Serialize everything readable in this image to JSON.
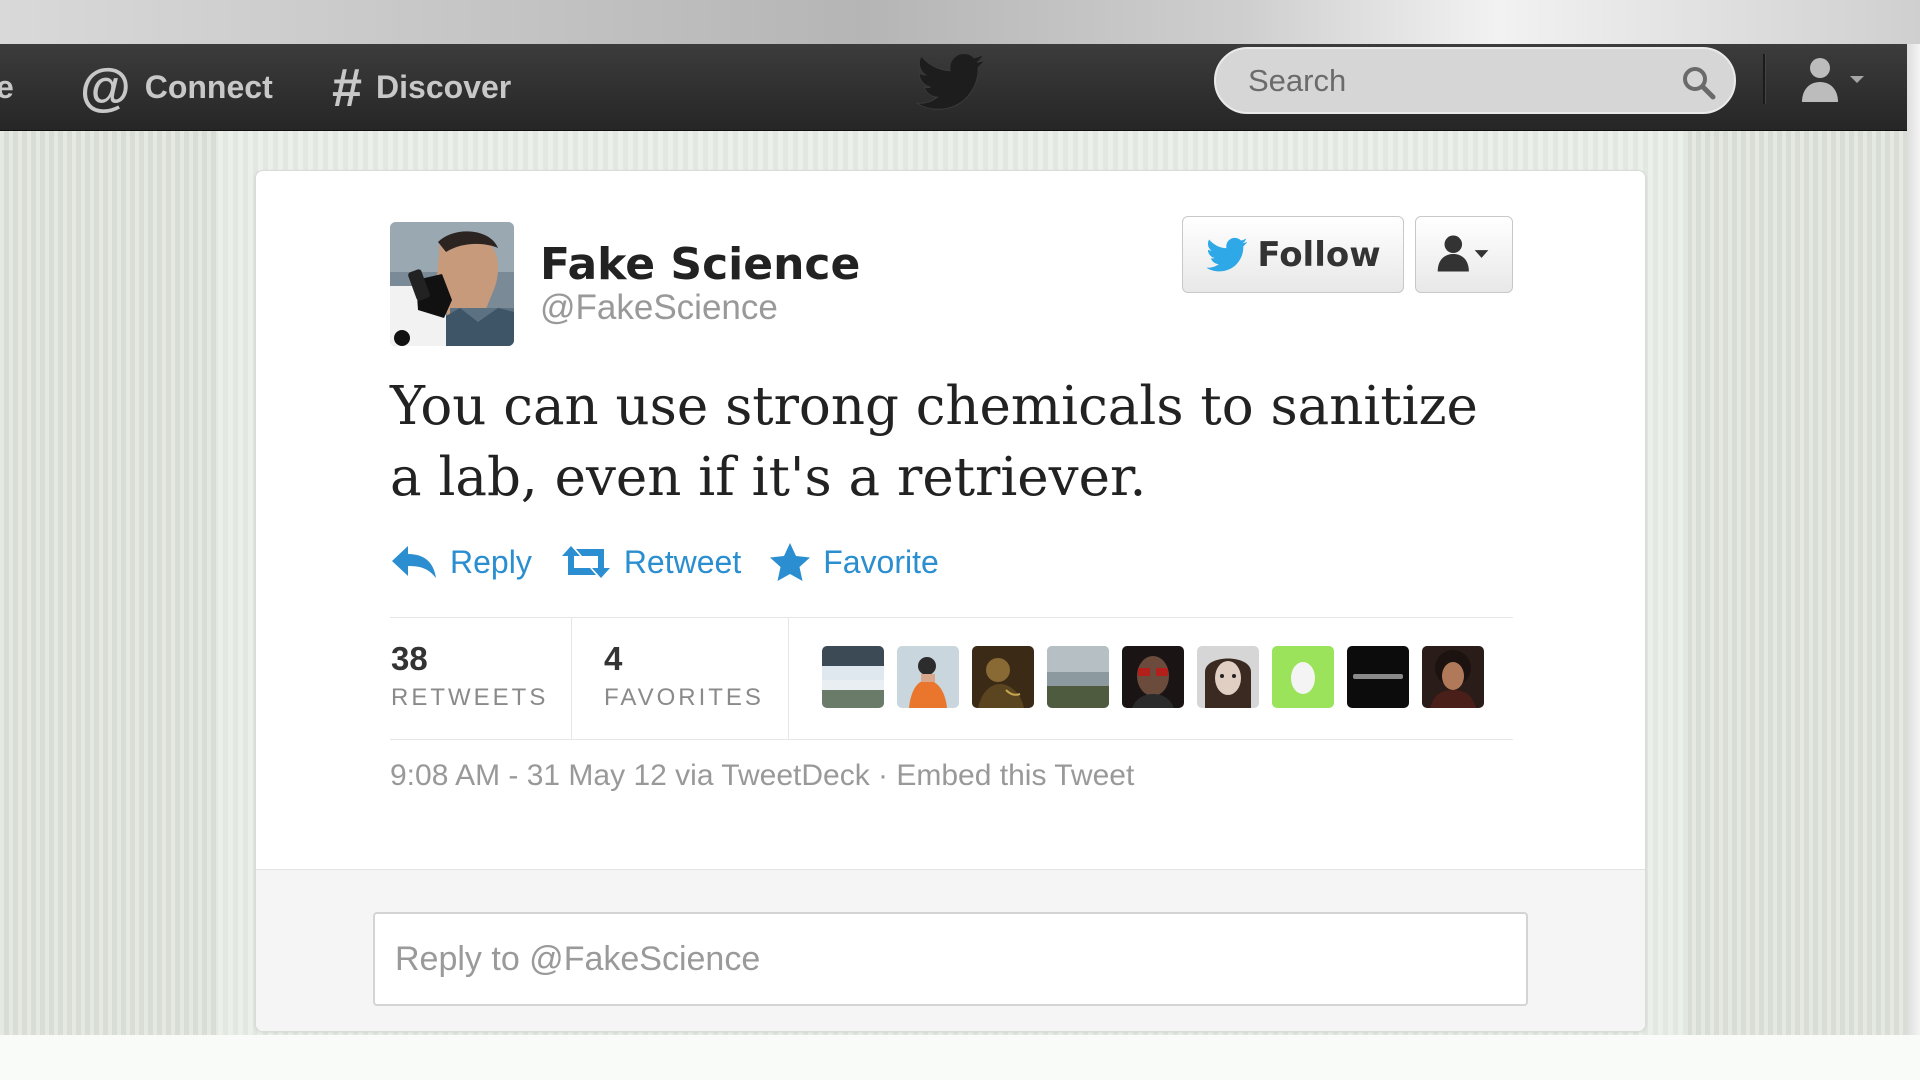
{
  "nav": {
    "home_fragment": "e",
    "connect_label": "Connect",
    "connect_glyph": "@",
    "discover_label": "Discover",
    "discover_glyph": "#",
    "search_placeholder": "Search"
  },
  "tweet": {
    "author_name": "Fake Science",
    "author_handle": "@FakeScience",
    "follow_label": "Follow",
    "text": "You can use strong chemicals to sanitize a lab, even if it's a retriever.",
    "actions": {
      "reply": "Reply",
      "retweet": "Retweet",
      "favorite": "Favorite"
    },
    "stats": {
      "retweets_count": "38",
      "retweets_label": "RETWEETS",
      "favorites_count": "4",
      "favorites_label": "FAVORITES"
    },
    "timestamp": "9:08 AM - 31 May 12",
    "via": "via TweetDeck",
    "embed_label": "Embed this Tweet"
  },
  "reply": {
    "placeholder": "Reply to @FakeScience"
  },
  "colors": {
    "link_blue": "#2a8ed0",
    "twitter_blue": "#2ea8e6",
    "navbar": "#2f2f2f"
  },
  "retweeter_avatars": [
    "avatar-landscape",
    "avatar-orange-jacket",
    "avatar-dark-portrait",
    "avatar-lake",
    "avatar-red-glasses",
    "avatar-woman",
    "avatar-egg",
    "avatar-black",
    "avatar-curly-hair"
  ]
}
